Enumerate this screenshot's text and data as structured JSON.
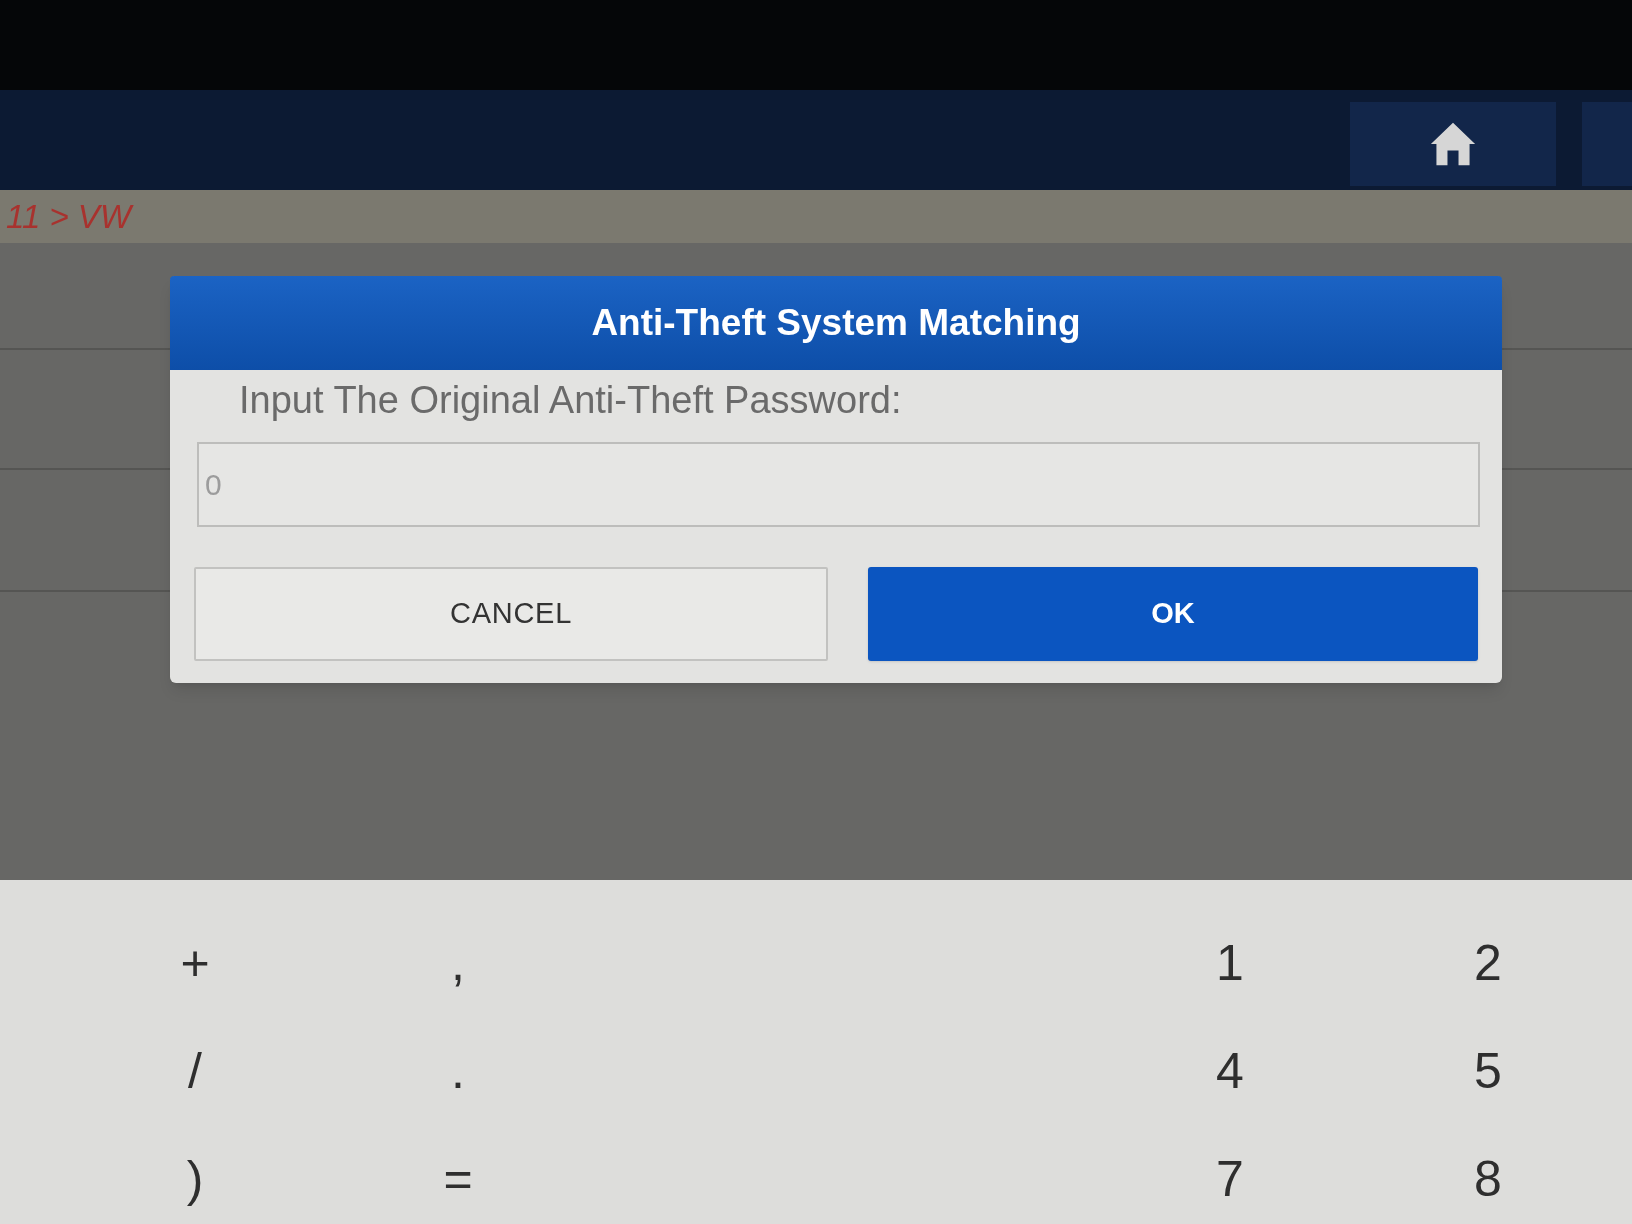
{
  "breadcrumb": "11 > VW",
  "dialog": {
    "title": "Anti-Theft System Matching",
    "prompt": "Input The Original Anti-Theft Password:",
    "password_field": {
      "placeholder": "0"
    },
    "buttons": [
      {
        "label": "CANCEL",
        "kind": "secondary"
      },
      {
        "label": "OK",
        "kind": "primary"
      }
    ]
  },
  "keyboard": {
    "rows": [
      [
        "+",
        ",",
        "1",
        "2"
      ],
      [
        "/",
        ".",
        "4",
        "5"
      ],
      [
        ")",
        "=",
        "7",
        "8"
      ]
    ]
  }
}
